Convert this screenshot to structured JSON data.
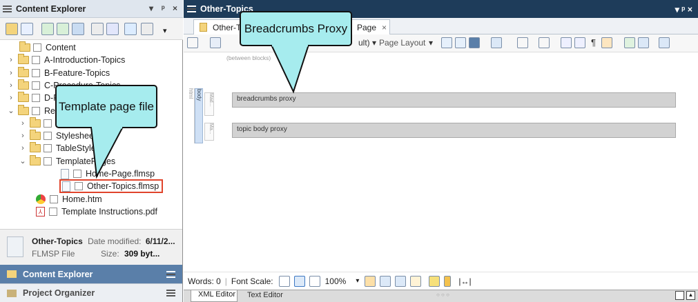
{
  "left_panel": {
    "title": "Content Explorer",
    "pin_glyph": "▾",
    "pin2_glyph": "ᵖ",
    "close_glyph": "×",
    "tree": [
      {
        "label": "Content",
        "indent": 0,
        "caret": "",
        "type": "folder-open"
      },
      {
        "label": "A-Introduction-Topics",
        "indent": 1,
        "caret": "›",
        "type": "folder"
      },
      {
        "label": "B-Feature-Topics",
        "indent": 1,
        "caret": "›",
        "type": "folder"
      },
      {
        "label": "C-Procedure-Topics",
        "indent": 1,
        "caret": "›",
        "type": "folder"
      },
      {
        "label": "D-Reference-Topics",
        "indent": 1,
        "caret": "›",
        "type": "folder"
      },
      {
        "label": "Resources",
        "indent": 1,
        "caret": "⌄",
        "type": "folder-open"
      },
      {
        "label": "Images",
        "indent": 2,
        "caret": "›",
        "type": "folder"
      },
      {
        "label": "Stylesheets",
        "indent": 2,
        "caret": "›",
        "type": "folder"
      },
      {
        "label": "TableStyles",
        "indent": 2,
        "caret": "›",
        "type": "folder"
      },
      {
        "label": "TemplatePages",
        "indent": 2,
        "caret": "⌄",
        "type": "folder-open"
      },
      {
        "label": "Home-Page.flmsp",
        "indent": 3,
        "caret": "",
        "type": "doc"
      },
      {
        "label": "Other-Topics.flmsp",
        "indent": 3,
        "caret": "",
        "type": "doc",
        "selected": true
      },
      {
        "label": "Home.htm",
        "indent": 1,
        "caret": "",
        "type": "web"
      },
      {
        "label": "Template Instructions.pdf",
        "indent": 1,
        "caret": "",
        "type": "pdf"
      }
    ],
    "info": {
      "name": "Other-Topics",
      "date_label": "Date modified:",
      "date": "6/11/2...",
      "type": "FLMSP File",
      "size_label": "Size:",
      "size": "309 byt..."
    },
    "pane_tabs": [
      "Content Explorer",
      "Project Organizer"
    ]
  },
  "editor": {
    "title": "Other-Topics",
    "title_controls": "▾ ᵖ ×",
    "tab_label": "Other-Topics",
    "tab_suffix": "Page",
    "tab_close": "×",
    "toolbar": {
      "layout_text": "ult)",
      "page_layout": "Page Layout"
    },
    "between_blocks": "(between blocks)",
    "side_labels": [
      "html",
      "body",
      "Mad...",
      "Ma..."
    ],
    "proxies": [
      "breadcrumbs proxy",
      "topic body proxy"
    ]
  },
  "status_bar": {
    "words": "Words: 0",
    "font_scale": "Font Scale:",
    "zoom": "100%"
  },
  "bottom_tabs": [
    "XML Editor",
    "Text Editor"
  ],
  "bottom_dots": "○ ○ ○",
  "callouts": {
    "breadcrumbs": "Breadcrumbs Proxy",
    "template": "Template page file"
  },
  "colors": {
    "title_dark": "#1e3c5a",
    "callout": "#a6ecee",
    "highlight": "#e0442b",
    "pane_header": "#5a7fa9"
  }
}
